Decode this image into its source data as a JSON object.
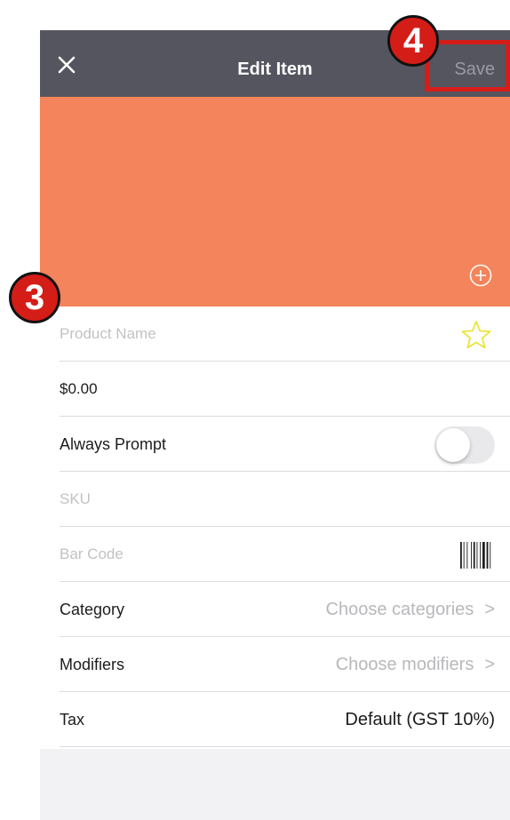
{
  "navbar": {
    "title": "Edit Item",
    "save_label": "Save",
    "close_icon": "close-icon"
  },
  "colors": {
    "navbar_bg": "#555560",
    "item_color": "#f4845b",
    "annotation_red": "#d51d18"
  },
  "image_area": {
    "add_icon": "plus-circle-icon"
  },
  "form": {
    "product_name_placeholder": "Product Name",
    "price": "$0.00",
    "always_prompt_label": "Always Prompt",
    "always_prompt_enabled": false,
    "sku_placeholder": "SKU",
    "barcode_placeholder": "Bar Code",
    "category_label": "Category",
    "category_value": "Choose categories",
    "modifiers_label": "Modifiers",
    "modifiers_value": "Choose modifiers",
    "tax_label": "Tax",
    "tax_value": "Default (GST 10%)",
    "chevron": ">"
  },
  "annotations": {
    "badge_3": "3",
    "badge_4": "4"
  }
}
